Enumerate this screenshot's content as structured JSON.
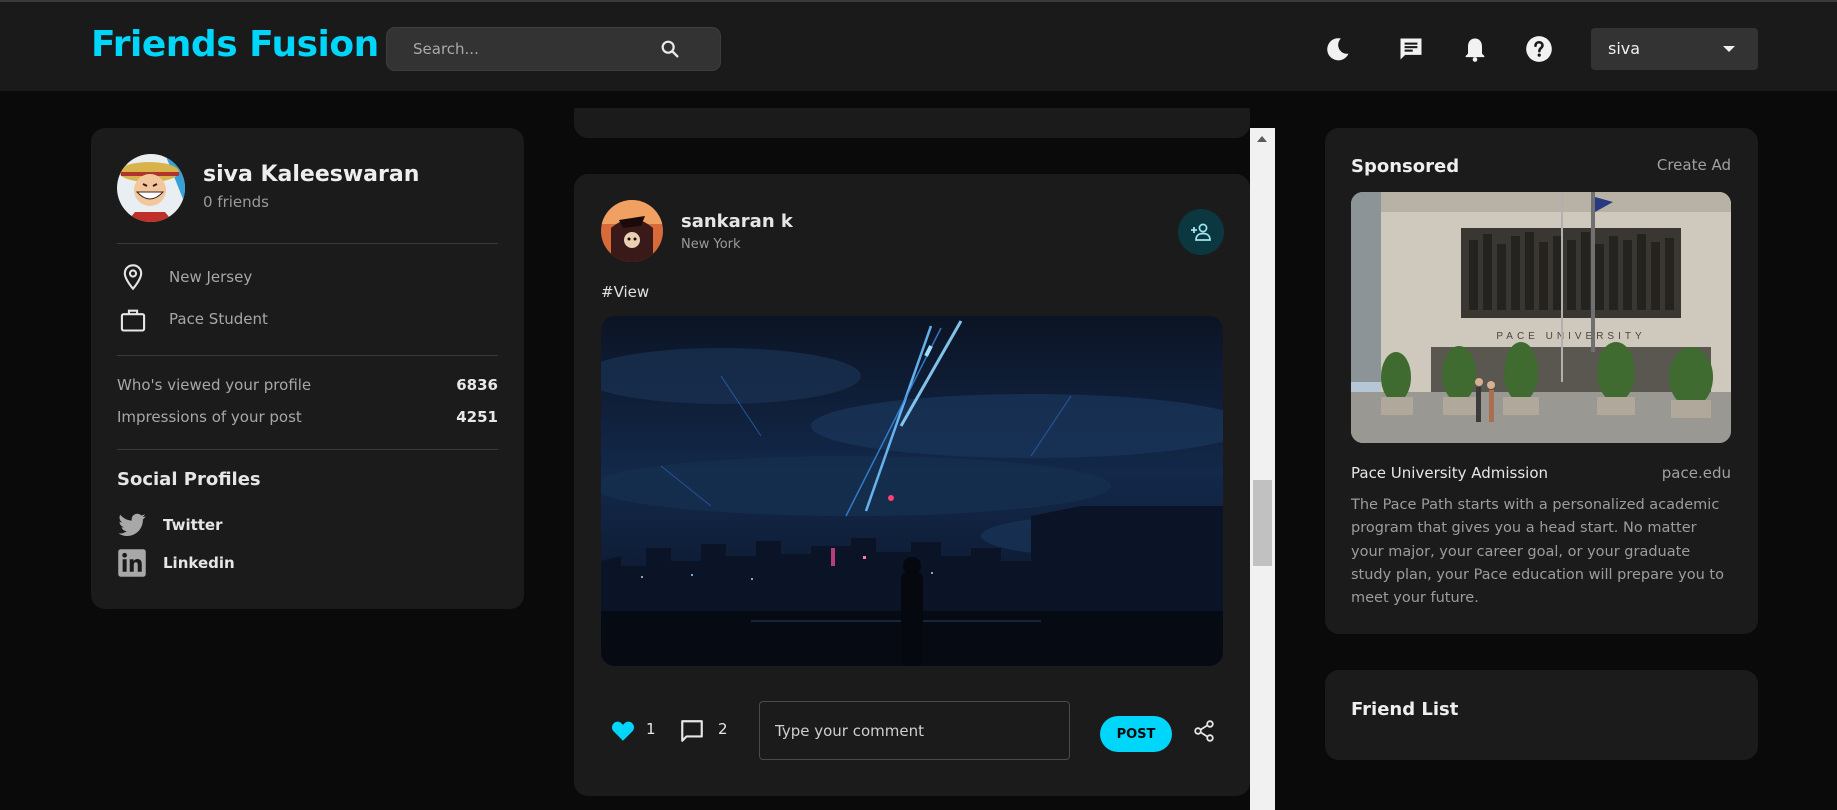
{
  "header": {
    "logo": "Friends Fusion",
    "search_placeholder": "Search...",
    "icons": [
      "moon-icon",
      "chat-icon",
      "bell-icon",
      "help-icon"
    ],
    "user_select": "siva"
  },
  "profile": {
    "name": "siva Kaleeswaran",
    "friends": "0 friends",
    "location": "New Jersey",
    "occupation": "Pace Student",
    "stats": [
      {
        "label": "Who's viewed your profile",
        "value": "6836"
      },
      {
        "label": "Impressions of your post",
        "value": "4251"
      }
    ],
    "social_title": "Social Profiles",
    "social": [
      {
        "label": "Twitter",
        "icon": "twitter-icon"
      },
      {
        "label": "Linkedin",
        "icon": "linkedin-icon"
      }
    ]
  },
  "post": {
    "author": "sankaran k",
    "location": "New York",
    "description": "#View",
    "likes": "1",
    "comments": "2",
    "comment_placeholder": "Type your comment",
    "post_button": "POST"
  },
  "sponsored": {
    "title": "Sponsored",
    "create_ad": "Create Ad",
    "ad_name": "Pace University Admission",
    "ad_domain": "pace.edu",
    "ad_description": "The Pace Path starts with a personalized academic program that gives you a head start. No matter your major, your career goal, or your graduate study plan, your Pace education will prepare you to meet your future.",
    "building_sign": "PACE UNIVERSITY"
  },
  "friend_list": {
    "title": "Friend List"
  },
  "colors": {
    "accent": "#00d5fa",
    "background": "#0a0a0a",
    "card": "#1b1b1b",
    "navbar": "#1a1a1a"
  }
}
